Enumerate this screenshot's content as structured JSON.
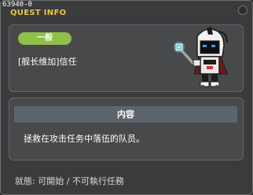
{
  "window": {
    "quest_id": "63940-0",
    "title": "QUEST INFO"
  },
  "quest": {
    "category": "一般",
    "name": "[舰长维加]信任"
  },
  "content": {
    "header": "内容",
    "text": "拯救在攻击任务中落伍的队员。"
  },
  "status": {
    "text": "就態:  可開始 / 不可執行任務"
  },
  "colors": {
    "title": "#e8c545",
    "badge": "#8fc04a",
    "panel": "#48494b"
  },
  "icons": {
    "npc": "npc-captain-sprite",
    "close": "close-icon"
  }
}
